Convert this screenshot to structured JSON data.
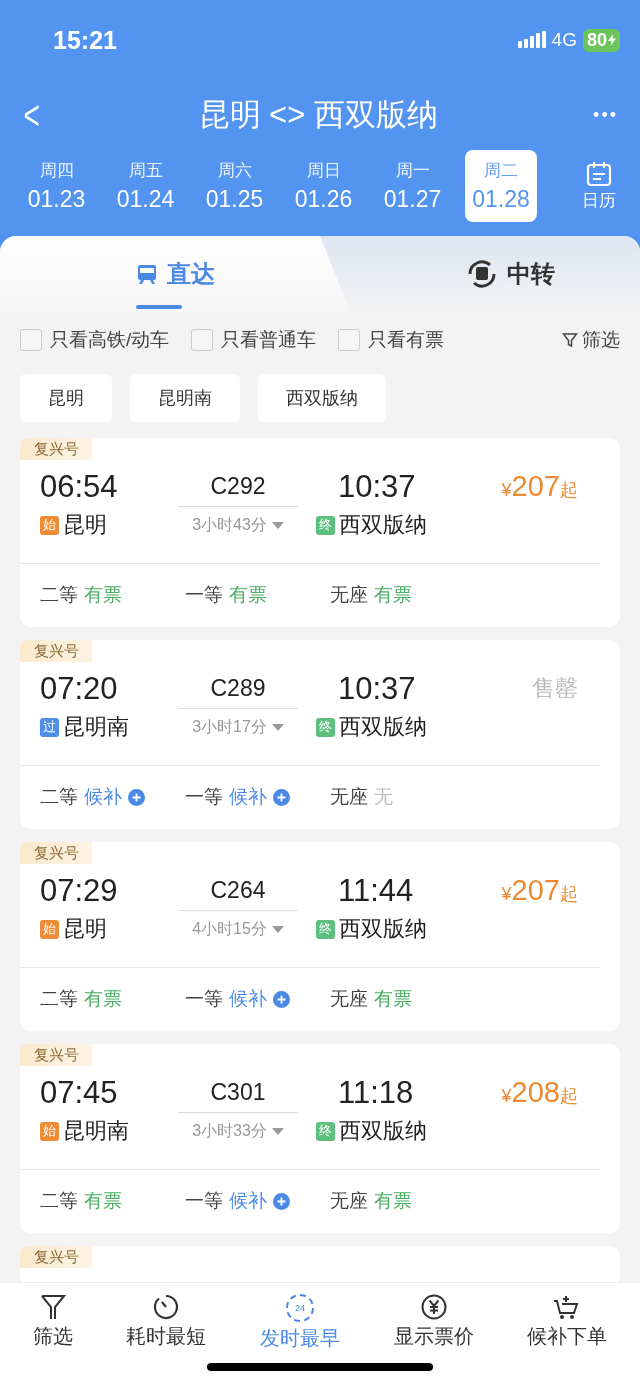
{
  "status_bar": {
    "time": "15:21",
    "network": "4G",
    "battery": "80"
  },
  "header": {
    "back": "<",
    "title": "昆明 <> 西双版纳",
    "more": "•••"
  },
  "dates": [
    {
      "weekday": "周四",
      "date": "01.23",
      "selected": false
    },
    {
      "weekday": "周五",
      "date": "01.24",
      "selected": false
    },
    {
      "weekday": "周六",
      "date": "01.25",
      "selected": false
    },
    {
      "weekday": "周日",
      "date": "01.26",
      "selected": false
    },
    {
      "weekday": "周一",
      "date": "01.27",
      "selected": false
    },
    {
      "weekday": "周二",
      "date": "01.28",
      "selected": true
    }
  ],
  "calendar": {
    "label": "日历"
  },
  "tabs": [
    {
      "label": "直达",
      "kind": "direct",
      "selected": true
    },
    {
      "label": "中转",
      "kind": "transfer",
      "selected": false
    }
  ],
  "filters": [
    {
      "label": "只看高铁/动车",
      "checked": false
    },
    {
      "label": "只看普通车",
      "checked": false
    },
    {
      "label": "只看有票",
      "checked": false
    }
  ],
  "filter_button": "筛选",
  "stations": [
    "昆明",
    "昆明南",
    "西双版纳"
  ],
  "trains": [
    {
      "tag": "复兴号",
      "depart": "06:54",
      "number": "C292",
      "duration": "3小时43分",
      "arrive": "10:37",
      "from": {
        "badge": "始",
        "color": "#ee8c35",
        "name": "昆明"
      },
      "to": {
        "badge": "终",
        "color": "#5dbf7e",
        "name": "西双版纳"
      },
      "fare": {
        "kind": "price",
        "currency": "¥",
        "amount": "207",
        "suffix": "起"
      },
      "seats": [
        {
          "class": "二等",
          "kind": "available",
          "status": "有票"
        },
        {
          "class": "一等",
          "kind": "available",
          "status": "有票"
        },
        {
          "class": "无座",
          "kind": "available",
          "status": "有票"
        }
      ]
    },
    {
      "tag": "复兴号",
      "depart": "07:20",
      "number": "C289",
      "duration": "3小时17分",
      "arrive": "10:37",
      "from": {
        "badge": "过",
        "color": "#4d8ee8",
        "name": "昆明南"
      },
      "to": {
        "badge": "终",
        "color": "#5dbf7e",
        "name": "西双版纳"
      },
      "fare": {
        "kind": "sold_out",
        "text": "售罄"
      },
      "seats": [
        {
          "class": "二等",
          "kind": "waitlist",
          "status": "候补"
        },
        {
          "class": "一等",
          "kind": "waitlist",
          "status": "候补"
        },
        {
          "class": "无座",
          "kind": "none",
          "status": "无"
        }
      ]
    },
    {
      "tag": "复兴号",
      "depart": "07:29",
      "number": "C264",
      "duration": "4小时15分",
      "arrive": "11:44",
      "from": {
        "badge": "始",
        "color": "#ee8c35",
        "name": "昆明"
      },
      "to": {
        "badge": "终",
        "color": "#5dbf7e",
        "name": "西双版纳"
      },
      "fare": {
        "kind": "price",
        "currency": "¥",
        "amount": "207",
        "suffix": "起"
      },
      "seats": [
        {
          "class": "二等",
          "kind": "available",
          "status": "有票"
        },
        {
          "class": "一等",
          "kind": "waitlist",
          "status": "候补"
        },
        {
          "class": "无座",
          "kind": "available",
          "status": "有票"
        }
      ]
    },
    {
      "tag": "复兴号",
      "depart": "07:45",
      "number": "C301",
      "duration": "3小时33分",
      "arrive": "11:18",
      "from": {
        "badge": "始",
        "color": "#ee8c35",
        "name": "昆明南"
      },
      "to": {
        "badge": "终",
        "color": "#5dbf7e",
        "name": "西双版纳"
      },
      "fare": {
        "kind": "price",
        "currency": "¥",
        "amount": "208",
        "suffix": "起"
      },
      "seats": [
        {
          "class": "二等",
          "kind": "available",
          "status": "有票"
        },
        {
          "class": "一等",
          "kind": "waitlist",
          "status": "候补"
        },
        {
          "class": "无座",
          "kind": "available",
          "status": "有票"
        }
      ]
    }
  ],
  "partial_train": {
    "tag": "复兴号"
  },
  "bottom_nav": [
    {
      "label": "筛选",
      "kind": "filter",
      "selected": false
    },
    {
      "label": "耗时最短",
      "kind": "timer",
      "selected": false
    },
    {
      "label": "发时最早",
      "kind": "earliest",
      "icon_text": "24",
      "selected": true
    },
    {
      "label": "显示票价",
      "kind": "yuan",
      "selected": false
    },
    {
      "label": "候补下单",
      "kind": "cart",
      "selected": false
    }
  ]
}
